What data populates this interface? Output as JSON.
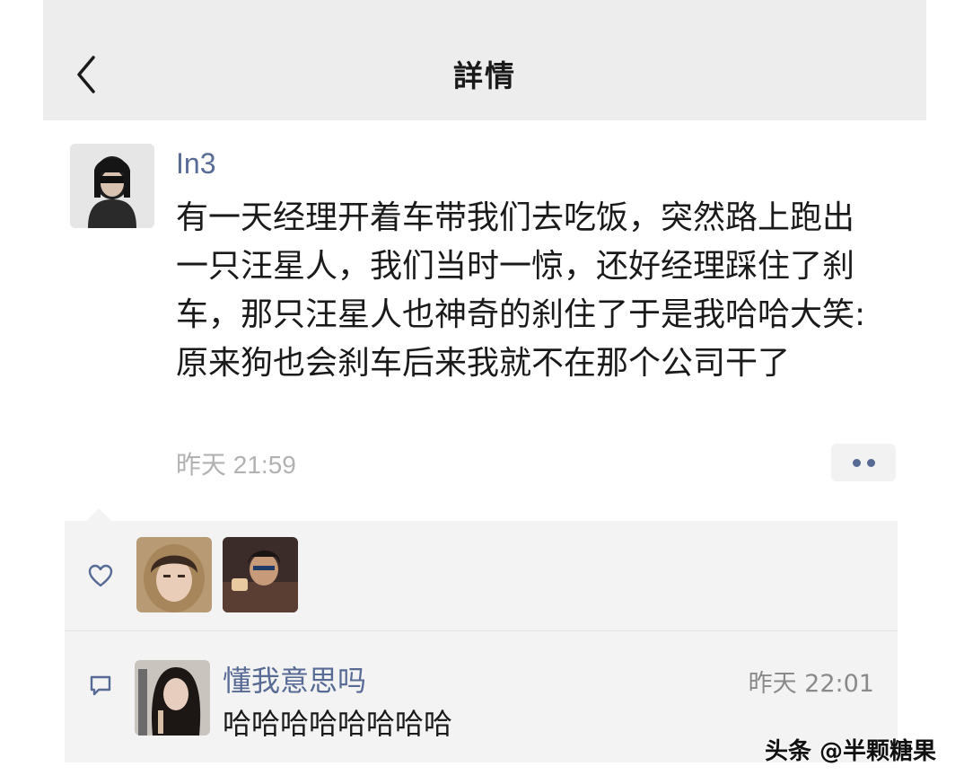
{
  "nav": {
    "title": "詳情"
  },
  "post": {
    "username": "In3",
    "text": "有一天经理开着车带我们去吃饭，突然路上跑出一只汪星人，我们当时一惊，还好经理踩住了刹车，那只汪星人也神奇的刹住了于是我哈哈大笑:原来狗也会刹车后来我就不在那个公司干了",
    "time": "昨天 21:59"
  },
  "likes": {
    "icon": "heart-icon",
    "count": 2
  },
  "comments": [
    {
      "name": "懂我意思吗",
      "text": "哈哈哈哈哈哈哈哈",
      "time": "昨天 22:01"
    }
  ],
  "watermark": "头条 @半颗糖果",
  "colors": {
    "nav_bg": "#ededed",
    "link_blue": "#576b95",
    "panel_bg": "#f3f3f3",
    "meta_gray": "#b2b2b2",
    "text": "#1a1a1a"
  }
}
